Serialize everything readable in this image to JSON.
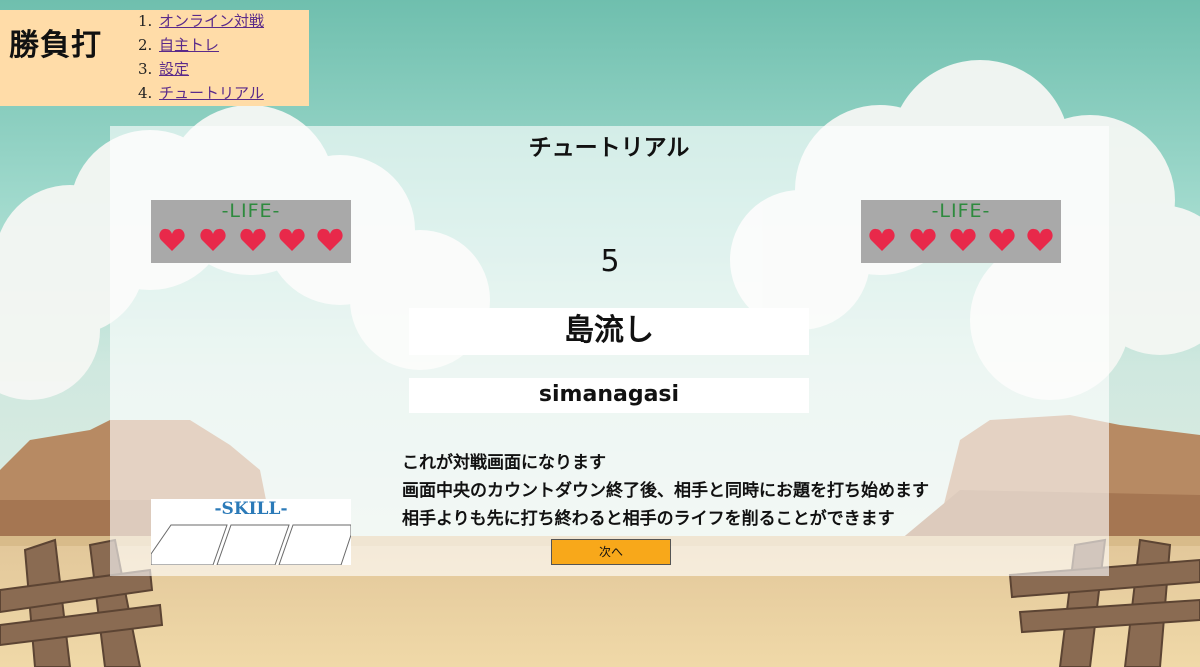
{
  "app": {
    "logo": "勝負打"
  },
  "nav": {
    "items": [
      {
        "num": "1.",
        "label": "オンライン対戦"
      },
      {
        "num": "2.",
        "label": "自主トレ"
      },
      {
        "num": "3.",
        "label": "設定"
      },
      {
        "num": "4.",
        "label": "チュートリアル"
      }
    ]
  },
  "main": {
    "title": "チュートリアル",
    "countdown": "5",
    "word": "島流し",
    "romaji": "simanagasi",
    "description": [
      "これが対戦画面になります",
      "画面中央のカウントダウン終了後、相手と同時にお題を打ち始めます",
      "相手よりも先に打ち終わると相手のライフを削ることができます"
    ],
    "next_label": "次へ"
  },
  "player_life": {
    "label": "-LIFE-",
    "hearts": 5
  },
  "opponent_life": {
    "label": "-LIFE-",
    "hearts": 5
  },
  "skill": {
    "label": "-SKILL-",
    "slots": 3
  },
  "colors": {
    "nav_bg": "#ffdca8",
    "life_bg": "#a9a9a9",
    "life_label": "#2e8a3e",
    "heart": "#e8294a",
    "skill_label": "#2b7ab8",
    "next_button": "#f8a81a"
  }
}
